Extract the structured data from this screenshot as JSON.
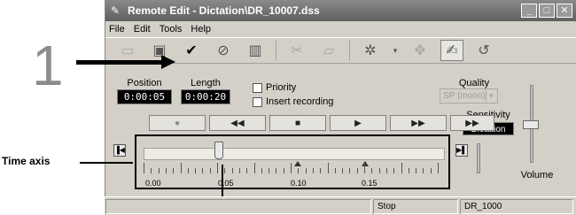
{
  "callouts": {
    "step_number": "1",
    "time_axis_label": "Time axis"
  },
  "window": {
    "title": "Remote Edit - Dictation\\DR_10007.dss",
    "controls": [
      "minimize",
      "maximize",
      "close"
    ]
  },
  "menu": {
    "items": [
      "File",
      "Edit",
      "Tools",
      "Help"
    ]
  },
  "toolbar": {
    "icons": [
      "new-icon",
      "save-icon",
      "checkmark-icon",
      "circle-check-icon",
      "book-icon",
      "cut-icon",
      "paste-icon",
      "settings-icon",
      "dropdown-icon",
      "export-icon",
      "edit-icon",
      "undo-icon"
    ]
  },
  "position": {
    "label": "Position",
    "value": "0:00:05"
  },
  "length": {
    "label": "Length",
    "value": "0:00:20"
  },
  "options": {
    "priority_label": "Priority",
    "insert_label": "Insert recording"
  },
  "quality": {
    "label": "Quality",
    "value": "SP (mono)"
  },
  "sensitivity": {
    "label": "Sensitivity",
    "value": "Dictation"
  },
  "volume": {
    "label": "Volume"
  },
  "transport": {
    "buttons": [
      "record",
      "rewind",
      "stop",
      "play",
      "fast-forward",
      "skip-end"
    ]
  },
  "timeline": {
    "tick_labels": [
      "0.00",
      "0.05",
      "0.10",
      "0.15"
    ],
    "position_fraction": 0.25
  },
  "status": {
    "state": "Stop",
    "device": "DR_1000"
  }
}
